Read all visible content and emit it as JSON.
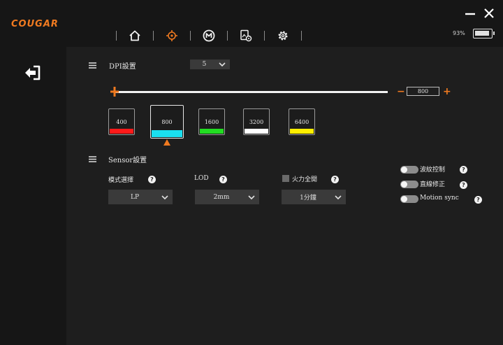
{
  "header": {
    "logo": "COUGAR",
    "battery_text": "93%",
    "battery_level": 0.93,
    "nav": [
      {
        "name": "home",
        "icon": "home-icon",
        "active": false
      },
      {
        "name": "mouse-settings",
        "icon": "crosshair-icon",
        "active": true
      },
      {
        "name": "macro",
        "icon": "macro-m-icon",
        "active": false
      },
      {
        "name": "profile",
        "icon": "image-gear-icon",
        "active": false
      },
      {
        "name": "settings",
        "icon": "gear-icon",
        "active": false
      }
    ],
    "window_controls": [
      "minimize-icon",
      "close-icon"
    ]
  },
  "sidebar": {
    "back_icon": "exit-arrow-icon"
  },
  "dpi": {
    "title": "DPI設置",
    "stages_select": "5",
    "value": "800",
    "stages": [
      {
        "label": "400",
        "color": "#ff1a1a"
      },
      {
        "label": "800",
        "color": "#1ae0f0",
        "selected": true
      },
      {
        "label": "1600",
        "color": "#22dd22"
      },
      {
        "label": "3200",
        "color": "#ffffff"
      },
      {
        "label": "6400",
        "color": "#ffee00"
      }
    ]
  },
  "sensor": {
    "title": "Sensor設置",
    "mode_label": "模式選擇",
    "mode_value": "LP",
    "lod_label": "LOD",
    "lod_value": "2mm",
    "fullspeed_label": "火力全開",
    "fullspeed_value": "1分鐘",
    "toggles": [
      {
        "label": "波紋控制"
      },
      {
        "label": "直線修正"
      },
      {
        "label": "Motion sync"
      }
    ]
  },
  "accent_color": "#f07a20"
}
